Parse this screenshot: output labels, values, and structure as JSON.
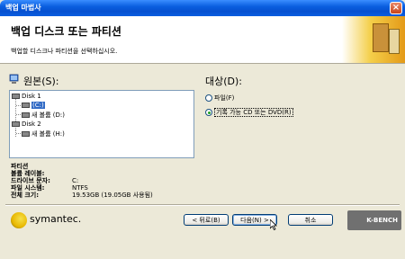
{
  "window": {
    "title": "백업 마법사",
    "close_glyph": "×"
  },
  "header": {
    "heading": "백업 디스크 또는 파티션",
    "description": "백업할 디스크나 파티션을 선택하십시오."
  },
  "source": {
    "label": "원본(S):",
    "tree": [
      {
        "label": "Disk 1"
      },
      {
        "label": "(C:)",
        "selected": true
      },
      {
        "label": "새 볼륨 (D:)"
      },
      {
        "label": "Disk 2"
      },
      {
        "label": "새 볼륨 (H:)"
      }
    ]
  },
  "info": {
    "section_title": "파티션",
    "labels": [
      "볼륨 레이블:",
      "드라이브 문자:",
      "파일 시스템:",
      "전체 크기:"
    ],
    "values": [
      "C:",
      "NTFS",
      "19.53GB (19.05GB 사용됨)"
    ]
  },
  "destination": {
    "label": "대상(D):",
    "options": [
      {
        "label": "파일(F)",
        "selected": false
      },
      {
        "label": "기록 가능 CD 또는 DVD(R)",
        "selected": true
      }
    ]
  },
  "footer": {
    "brand": "symantec.",
    "back": "< 뒤로(B)",
    "next": "다음(N) >",
    "cancel": "취소",
    "watermark": "K-BENCH"
  }
}
